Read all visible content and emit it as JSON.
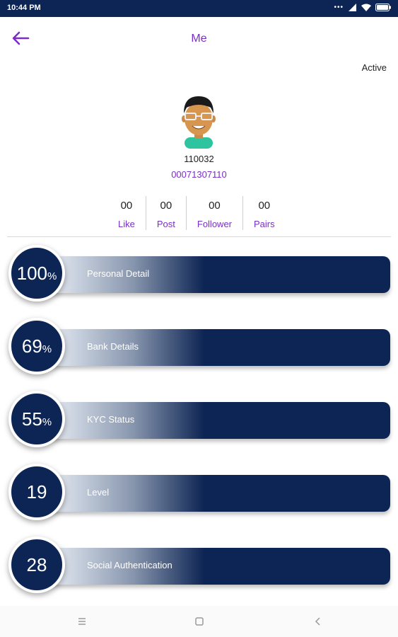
{
  "status_bar": {
    "time": "10:44 PM",
    "dots": "•••"
  },
  "header": {
    "title": "Me"
  },
  "profile": {
    "status": "Active",
    "user_id": "110032",
    "code": "00071307110"
  },
  "stats": [
    {
      "value": "00",
      "label": "Like"
    },
    {
      "value": "00",
      "label": "Post"
    },
    {
      "value": "00",
      "label": "Follower"
    },
    {
      "value": "00",
      "label": "Pairs"
    }
  ],
  "cards": [
    {
      "value": "100",
      "unit": "%",
      "label": "Personal Detail"
    },
    {
      "value": "69",
      "unit": "%",
      "label": "Bank Details"
    },
    {
      "value": "55",
      "unit": "%",
      "label": "KYC Status"
    },
    {
      "value": "19",
      "unit": "",
      "label": "Level"
    },
    {
      "value": "28",
      "unit": "",
      "label": "Social Authentication"
    }
  ],
  "colors": {
    "navy": "#0d2554",
    "accent": "#7a2ec9"
  },
  "icons": {
    "back": "arrow-left-icon",
    "menu": "menu-icon",
    "home": "square-icon",
    "back_nav": "chevron-left-icon"
  }
}
